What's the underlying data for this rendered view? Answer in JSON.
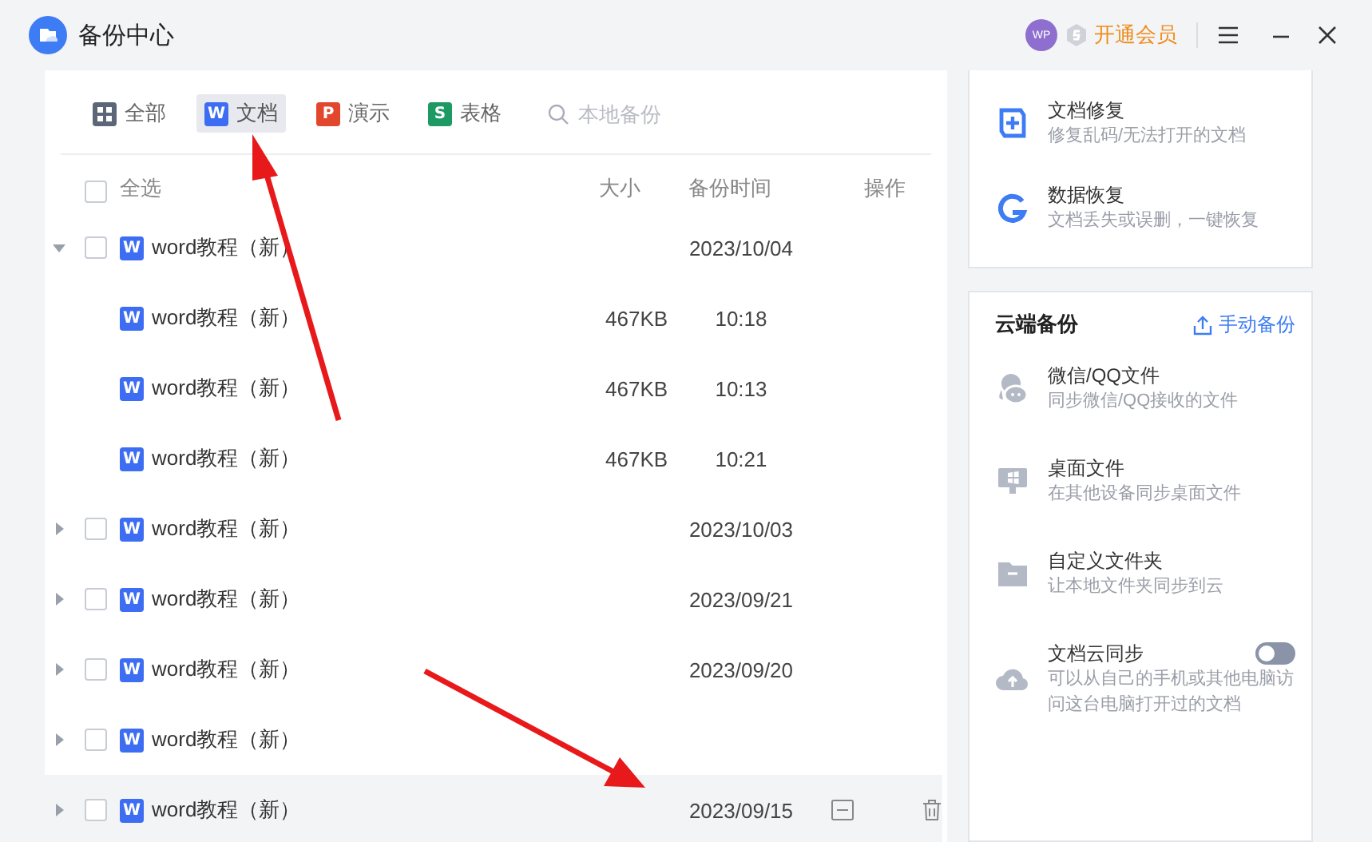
{
  "window": {
    "title": "备份中心"
  },
  "header": {
    "avatar": "WP",
    "vip_link": "开通会员"
  },
  "tabs": [
    {
      "label": "全部",
      "kind": "all",
      "selected": false
    },
    {
      "label": "文档",
      "kind": "doc",
      "icon_letter": "W",
      "selected": true
    },
    {
      "label": "演示",
      "kind": "ppt",
      "icon_letter": "P",
      "selected": false
    },
    {
      "label": "表格",
      "kind": "sheet",
      "icon_letter": "S",
      "selected": false
    }
  ],
  "search": {
    "placeholder": "本地备份"
  },
  "table": {
    "select_all": {
      "label": "全选",
      "checked": false
    },
    "columns": [
      "大小",
      "备份时间",
      "操作"
    ],
    "rows": [
      {
        "name": "word教程（新）",
        "icon_letter": "W",
        "time": "2023/10/04",
        "expanded": true,
        "checked": false,
        "hovered": false,
        "children": [
          {
            "name": "word教程（新）",
            "icon_letter": "W",
            "size": "467KB",
            "time": "10:18"
          },
          {
            "name": "word教程（新）",
            "icon_letter": "W",
            "size": "467KB",
            "time": "10:13"
          },
          {
            "name": "word教程（新）",
            "icon_letter": "W",
            "size": "467KB",
            "time": "10:21"
          }
        ]
      },
      {
        "name": "word教程（新）",
        "icon_letter": "W",
        "time": "2023/10/03",
        "expanded": false,
        "checked": false,
        "hovered": false
      },
      {
        "name": "word教程（新）",
        "icon_letter": "W",
        "time": "2023/09/21",
        "expanded": false,
        "checked": false,
        "hovered": false
      },
      {
        "name": "word教程（新）",
        "icon_letter": "W",
        "time": "2023/09/20",
        "expanded": false,
        "checked": false,
        "hovered": false
      },
      {
        "name": "word教程（新）",
        "icon_letter": "W",
        "expanded": false,
        "checked": false,
        "hovered": false
      },
      {
        "name": "word教程（新）",
        "icon_letter": "W",
        "time": "2023/09/15",
        "expanded": false,
        "checked": false,
        "hovered": true
      }
    ]
  },
  "tools": [
    {
      "kind": "repair",
      "title": "文档修复",
      "subtitle": "修复乱码/无法打开的文档"
    },
    {
      "kind": "recover",
      "title": "数据恢复",
      "subtitle": "文档丢失或误删，一键恢复"
    }
  ],
  "cloud_backup": {
    "title": "云端备份",
    "action": "手动备份",
    "items": [
      {
        "kind": "chat",
        "title": "微信/QQ文件",
        "subtitle": "同步微信/QQ接收的文件"
      },
      {
        "kind": "desktop",
        "title": "桌面文件",
        "subtitle": "在其他设备同步桌面文件"
      },
      {
        "kind": "folder",
        "title": "自定义文件夹",
        "subtitle": "让本地文件夹同步到云"
      },
      {
        "kind": "sync",
        "title": "文档云同步",
        "subtitle": "可以从自己的手机或其他电脑访问这台电脑打开过的文档",
        "on": false
      }
    ]
  }
}
